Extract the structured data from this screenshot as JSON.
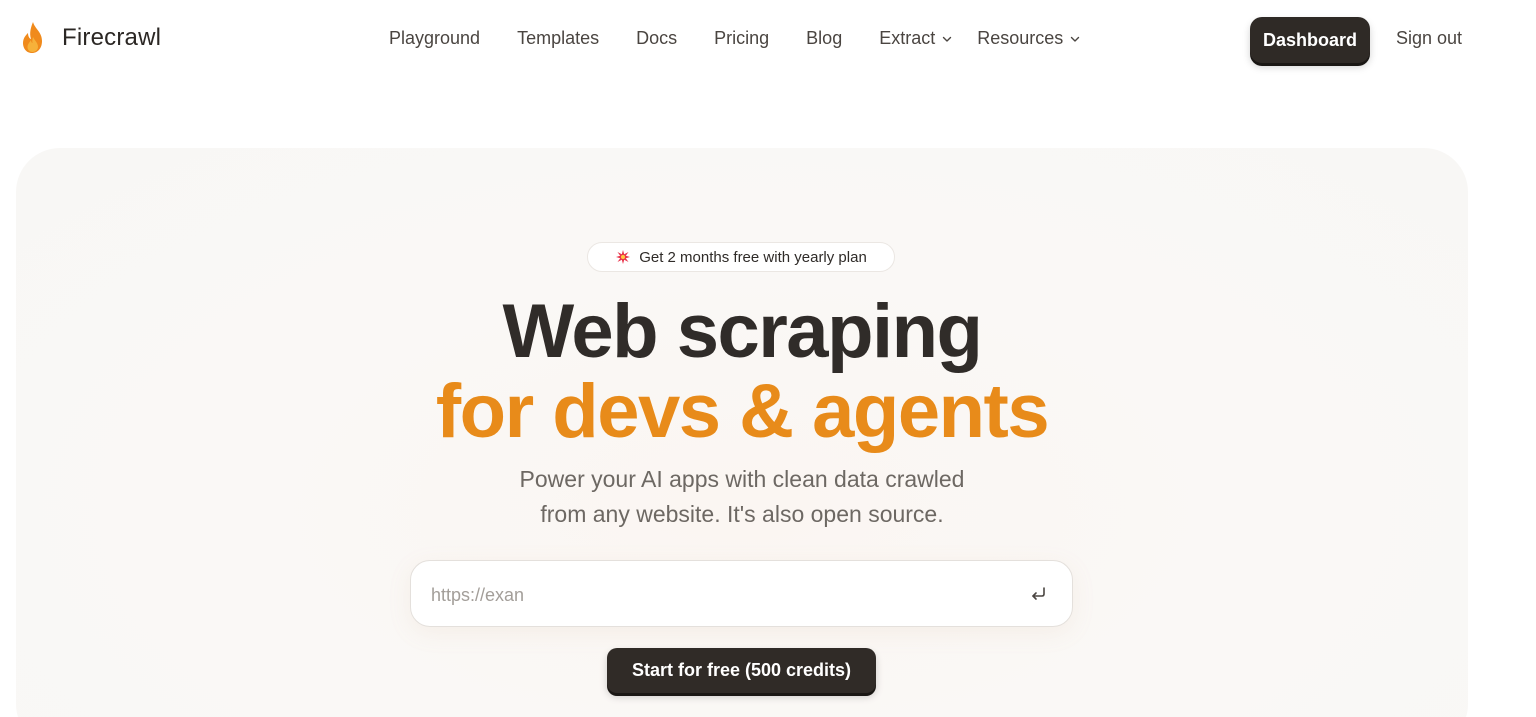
{
  "header": {
    "brand_name": "Firecrawl",
    "nav": [
      {
        "label": "Playground"
      },
      {
        "label": "Templates"
      },
      {
        "label": "Docs"
      },
      {
        "label": "Pricing"
      },
      {
        "label": "Blog"
      },
      {
        "label": "Extract",
        "dropdown": true
      },
      {
        "label": "Resources",
        "dropdown": true
      }
    ],
    "dashboard_label": "Dashboard",
    "signout_label": "Sign out"
  },
  "hero": {
    "badge_text": "Get 2 months free with yearly plan",
    "title_line1": "Web scraping",
    "title_line2": "for devs & agents",
    "subtitle_line1": "Power your AI apps with clean data crawled",
    "subtitle_line2": "from any website. It's also open source.",
    "url_input": {
      "value": "",
      "placeholder": "https://exan"
    },
    "cta_label": "Start for free (500 credits)"
  },
  "colors": {
    "accent_orange": "#e88b1a",
    "dark_button": "#302b27",
    "hero_background": "#f9f7f5"
  },
  "icons": {
    "brand": "flame-icon",
    "badge": "sparkle-burst-icon",
    "enter": "enter-return-icon",
    "dropdown": "chevron-down-icon"
  }
}
